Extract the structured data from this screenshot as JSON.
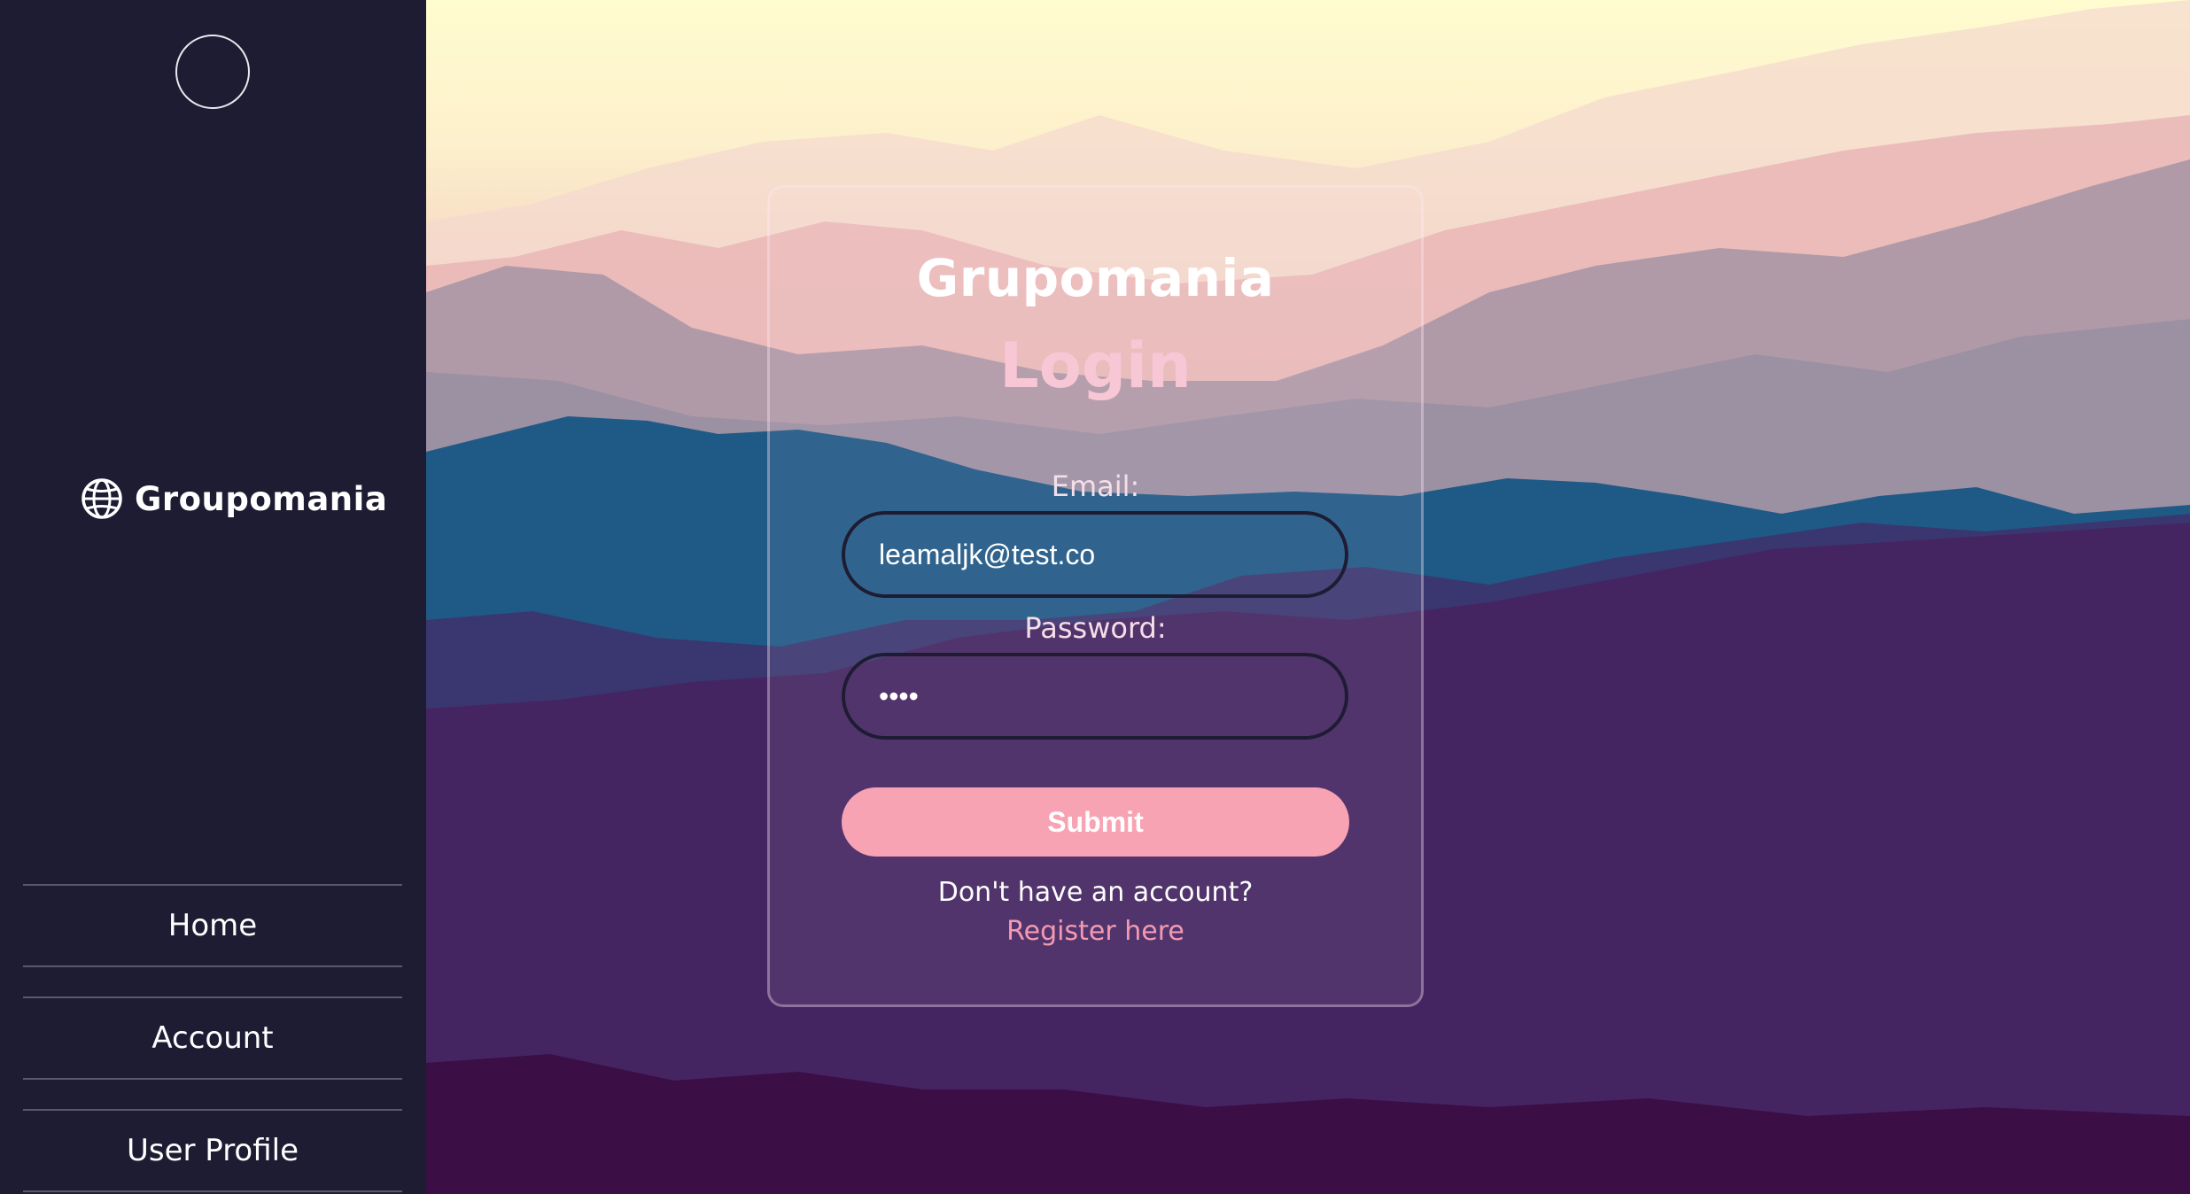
{
  "sidebar": {
    "brand": "Groupomania",
    "nav": [
      {
        "label": "Home"
      },
      {
        "label": "Account"
      },
      {
        "label": "User Profile"
      }
    ]
  },
  "login": {
    "title": "Grupomania",
    "heading": "Login",
    "email_label": "Email:",
    "email_value": "leamaljk@test.co",
    "password_label": "Password:",
    "password_value": "••••",
    "submit_label": "Submit",
    "no_account_text": "Don't have an account?",
    "register_link": "Register here"
  },
  "colors": {
    "sidebar_bg": "#1e1c33",
    "accent_pink": "#f8a3b3",
    "link_pink": "#f49ab0"
  },
  "icons": {
    "brand": "globe-icon"
  }
}
